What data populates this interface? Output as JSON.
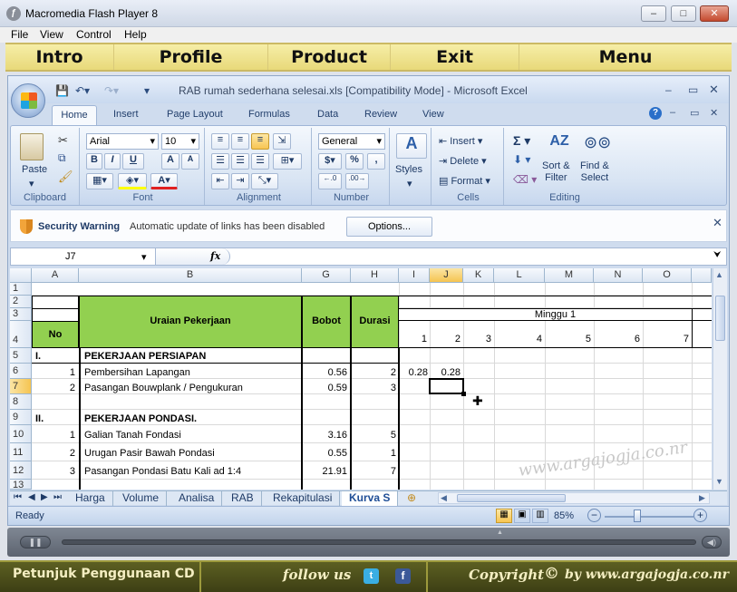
{
  "flash": {
    "title": "Macromedia Flash Player 8",
    "menu": [
      "File",
      "View",
      "Control",
      "Help"
    ],
    "nav": [
      "Intro",
      "Profile",
      "Product",
      "Exit",
      "Menu"
    ]
  },
  "excel": {
    "title": "RAB rumah sederhana selesai.xls  [Compatibility Mode] - Microsoft Excel",
    "tabs": [
      "Home",
      "Insert",
      "Page Layout",
      "Formulas",
      "Data",
      "Review",
      "View"
    ],
    "ribbon": {
      "paste": "Paste",
      "clipboard": "Clipboard",
      "font_name": "Arial",
      "font_size": "10",
      "font_group": "Font",
      "alignment": "Alignment",
      "number_format": "General",
      "number_group": "Number",
      "styles": "Styles",
      "insert": "Insert",
      "delete": "Delete",
      "format": "Format",
      "cells": "Cells",
      "sort_filter": "Sort &\nFilter",
      "find_select": "Find &\nSelect",
      "editing": "Editing",
      "bold": "B",
      "italic": "I",
      "underline": "U",
      "grow": "A",
      "shrink": "A",
      "sigma": "Σ",
      "dollar": "$",
      "percent": "%",
      "comma": ","
    },
    "security": {
      "label": "Security Warning",
      "message": "Automatic update of links has been disabled",
      "button": "Options..."
    },
    "namebox": "J7",
    "fx": "fx",
    "columns": [
      "A",
      "B",
      "G",
      "H",
      "I",
      "J",
      "K",
      "L",
      "M",
      "N",
      "O"
    ],
    "rows": [
      "1",
      "2",
      "3",
      "4",
      "5",
      "6",
      "7",
      "8",
      "9",
      "10",
      "11",
      "12",
      "13"
    ],
    "headers": {
      "no": "No",
      "uraian": "Uraian Pekerjaan",
      "bobot": "Bobot",
      "durasi": "Durasi",
      "minggu": "Minggu 1",
      "weeks": [
        "1",
        "2",
        "3",
        "4",
        "5",
        "6",
        "7"
      ]
    },
    "data": [
      {
        "a": "I.",
        "b": "PEKERJAAN PERSIAPAN",
        "g": "",
        "h": "",
        "i": "",
        "j": ""
      },
      {
        "a": "1",
        "b": "Pembersihan Lapangan",
        "g": "0.56",
        "h": "2",
        "i": "0.28",
        "j": "0.28"
      },
      {
        "a": "2",
        "b": "Pasangan Bouwplank / Pengukuran",
        "g": "0.59",
        "h": "3",
        "i": "",
        "j": ""
      },
      {
        "a": "",
        "b": "",
        "g": "",
        "h": "",
        "i": "",
        "j": ""
      },
      {
        "a": "II.",
        "b": "PEKERJAAN PONDASI.",
        "g": "",
        "h": "",
        "i": "",
        "j": ""
      },
      {
        "a": "1",
        "b": "Galian Tanah Fondasi",
        "g": "3.16",
        "h": "5",
        "i": "",
        "j": ""
      },
      {
        "a": "2",
        "b": "Urugan Pasir Bawah Pondasi",
        "g": "0.55",
        "h": "1",
        "i": "",
        "j": ""
      },
      {
        "a": "3",
        "b": "Pasangan Pondasi Batu Kali ad 1:4",
        "g": "21.91",
        "h": "7",
        "i": "",
        "j": ""
      }
    ],
    "sheets": [
      "Harga",
      "Volume",
      "Analisa",
      "RAB",
      "Rekapitulasi",
      "Kurva S"
    ],
    "status": "Ready",
    "zoom": "85%",
    "watermark": "www.argajogja.co.nr"
  },
  "footer": {
    "guide": "Petunjuk Penggunaan CD",
    "follow": "follow us",
    "copyright": "Copyright",
    "site": "by www.argajogja.co.nr"
  }
}
